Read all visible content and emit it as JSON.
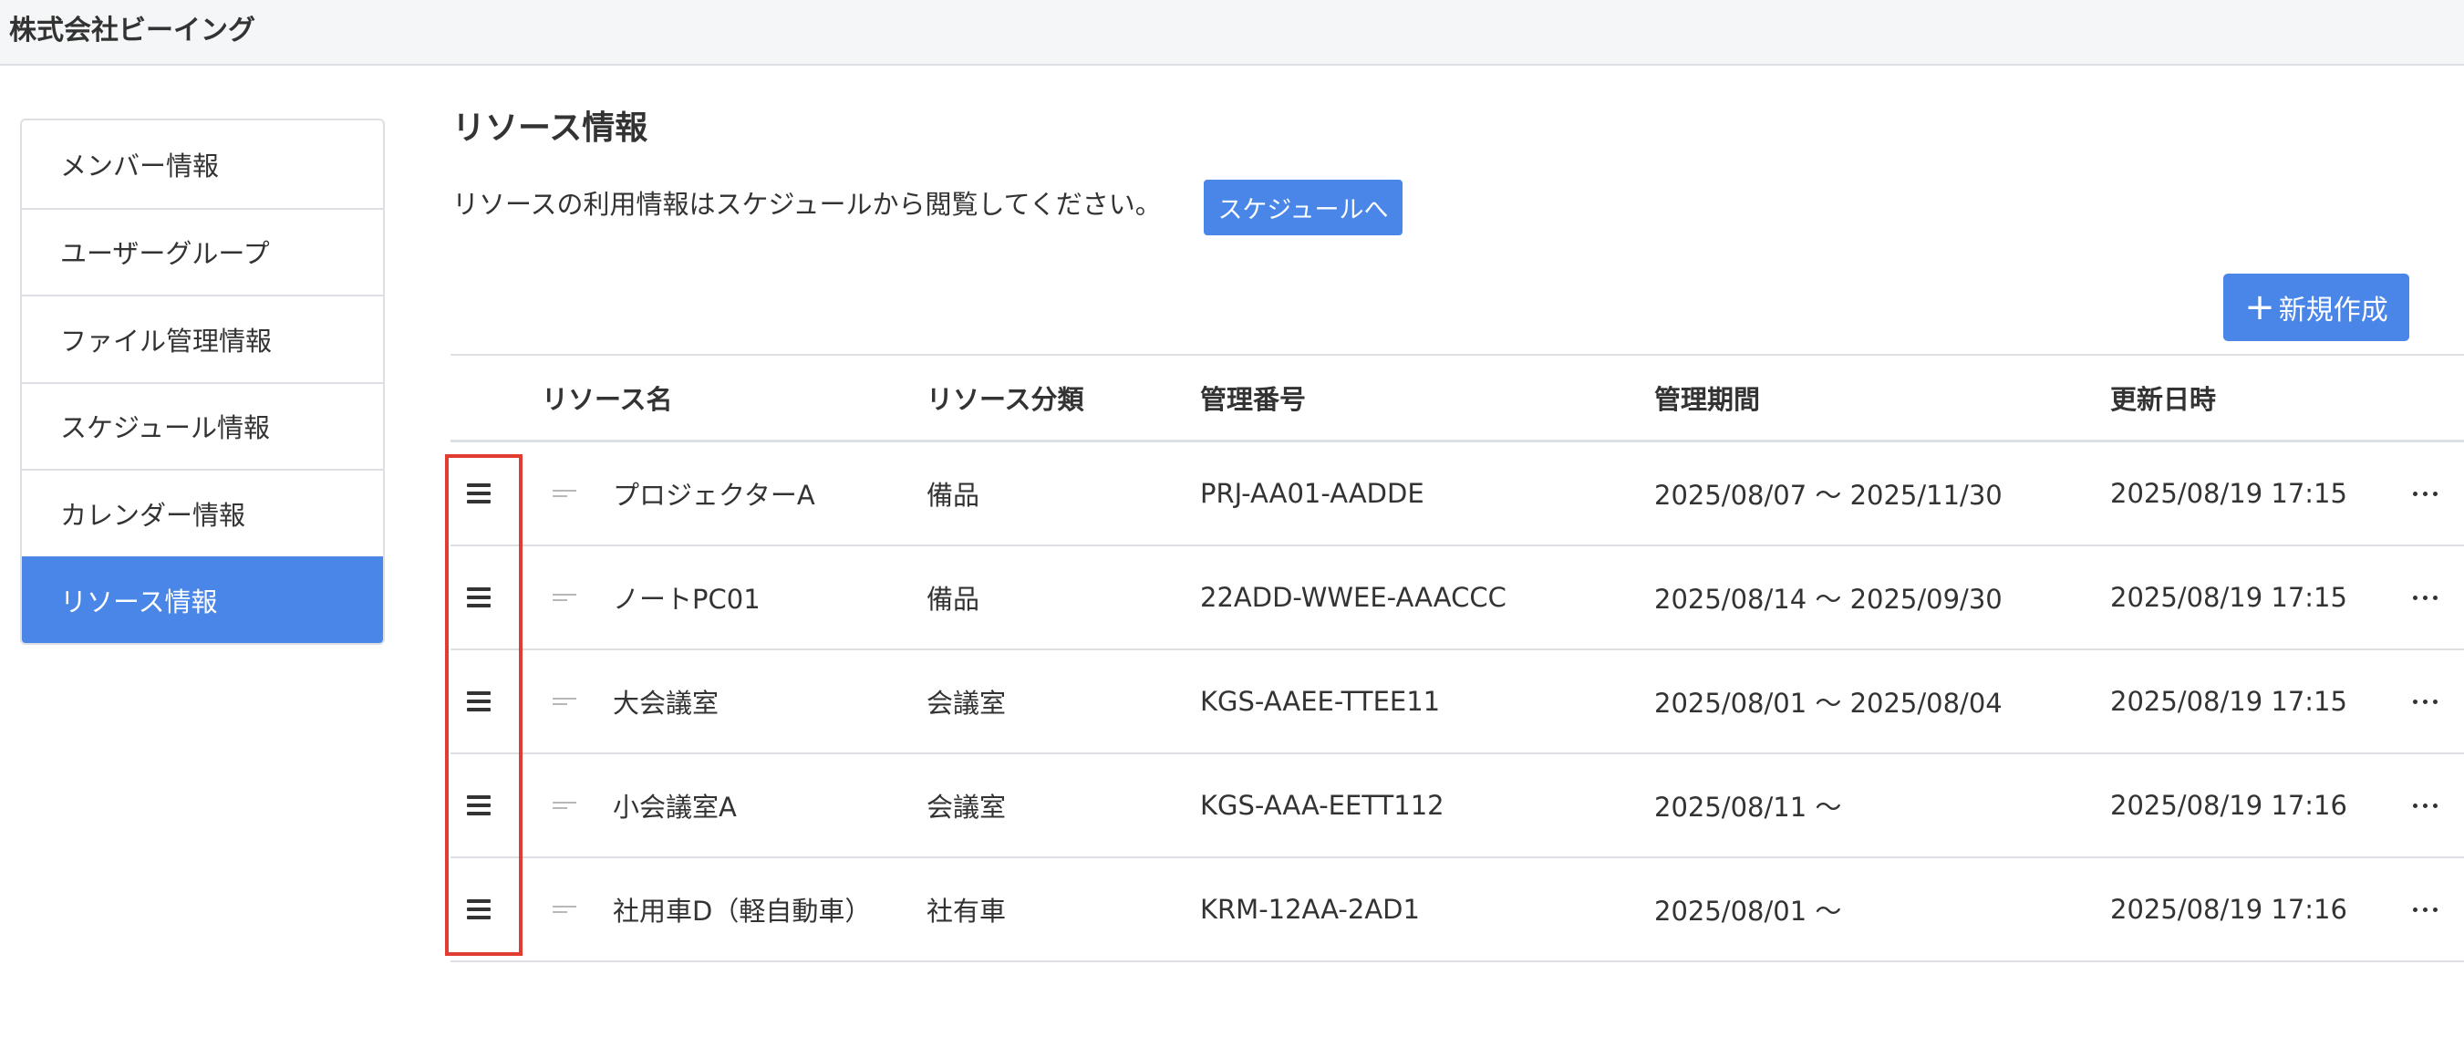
{
  "header": {
    "company": "株式会社ビーイング"
  },
  "sidebar": {
    "items": [
      {
        "label": "メンバー情報"
      },
      {
        "label": "ユーザーグループ"
      },
      {
        "label": "ファイル管理情報"
      },
      {
        "label": "スケジュール情報"
      },
      {
        "label": "カレンダー情報"
      },
      {
        "label": "リソース情報",
        "active": true
      }
    ]
  },
  "main": {
    "title": "リソース情報",
    "description": "リソースの利用情報はスケジュールから閲覧してください。",
    "schedule_button": "スケジュールへ",
    "new_button": "新規作成",
    "new_button_icon": "+"
  },
  "table": {
    "columns": [
      "リソース名",
      "リソース分類",
      "管理番号",
      "管理期間",
      "更新日時"
    ],
    "rows": [
      {
        "name": "プロジェクターA",
        "category": "備品",
        "code": "PRJ-AA01-AADDE",
        "period": "2025/08/07 〜 2025/11/30",
        "updated": "2025/08/19 17:15"
      },
      {
        "name": "ノートPC01",
        "category": "備品",
        "code": "22ADD-WWEE-AAACCC",
        "period": "2025/08/14 〜 2025/09/30",
        "updated": "2025/08/19 17:15"
      },
      {
        "name": "大会議室",
        "category": "会議室",
        "code": "KGS-AAEE-TTEE11",
        "period": "2025/08/01 〜 2025/08/04",
        "updated": "2025/08/19 17:15"
      },
      {
        "name": "小会議室A",
        "category": "会議室",
        "code": "KGS-AAA-EETT112",
        "period": "2025/08/11 〜",
        "updated": "2025/08/19 17:16"
      },
      {
        "name": "社用車D（軽自動車）",
        "category": "社有車",
        "code": "KRM-12AA-2AD1",
        "period": "2025/08/01 〜",
        "updated": "2025/08/19 17:16"
      }
    ]
  },
  "colors": {
    "accent": "#4a86e8",
    "highlight": "#e03c31",
    "border": "#dcdfe3"
  }
}
